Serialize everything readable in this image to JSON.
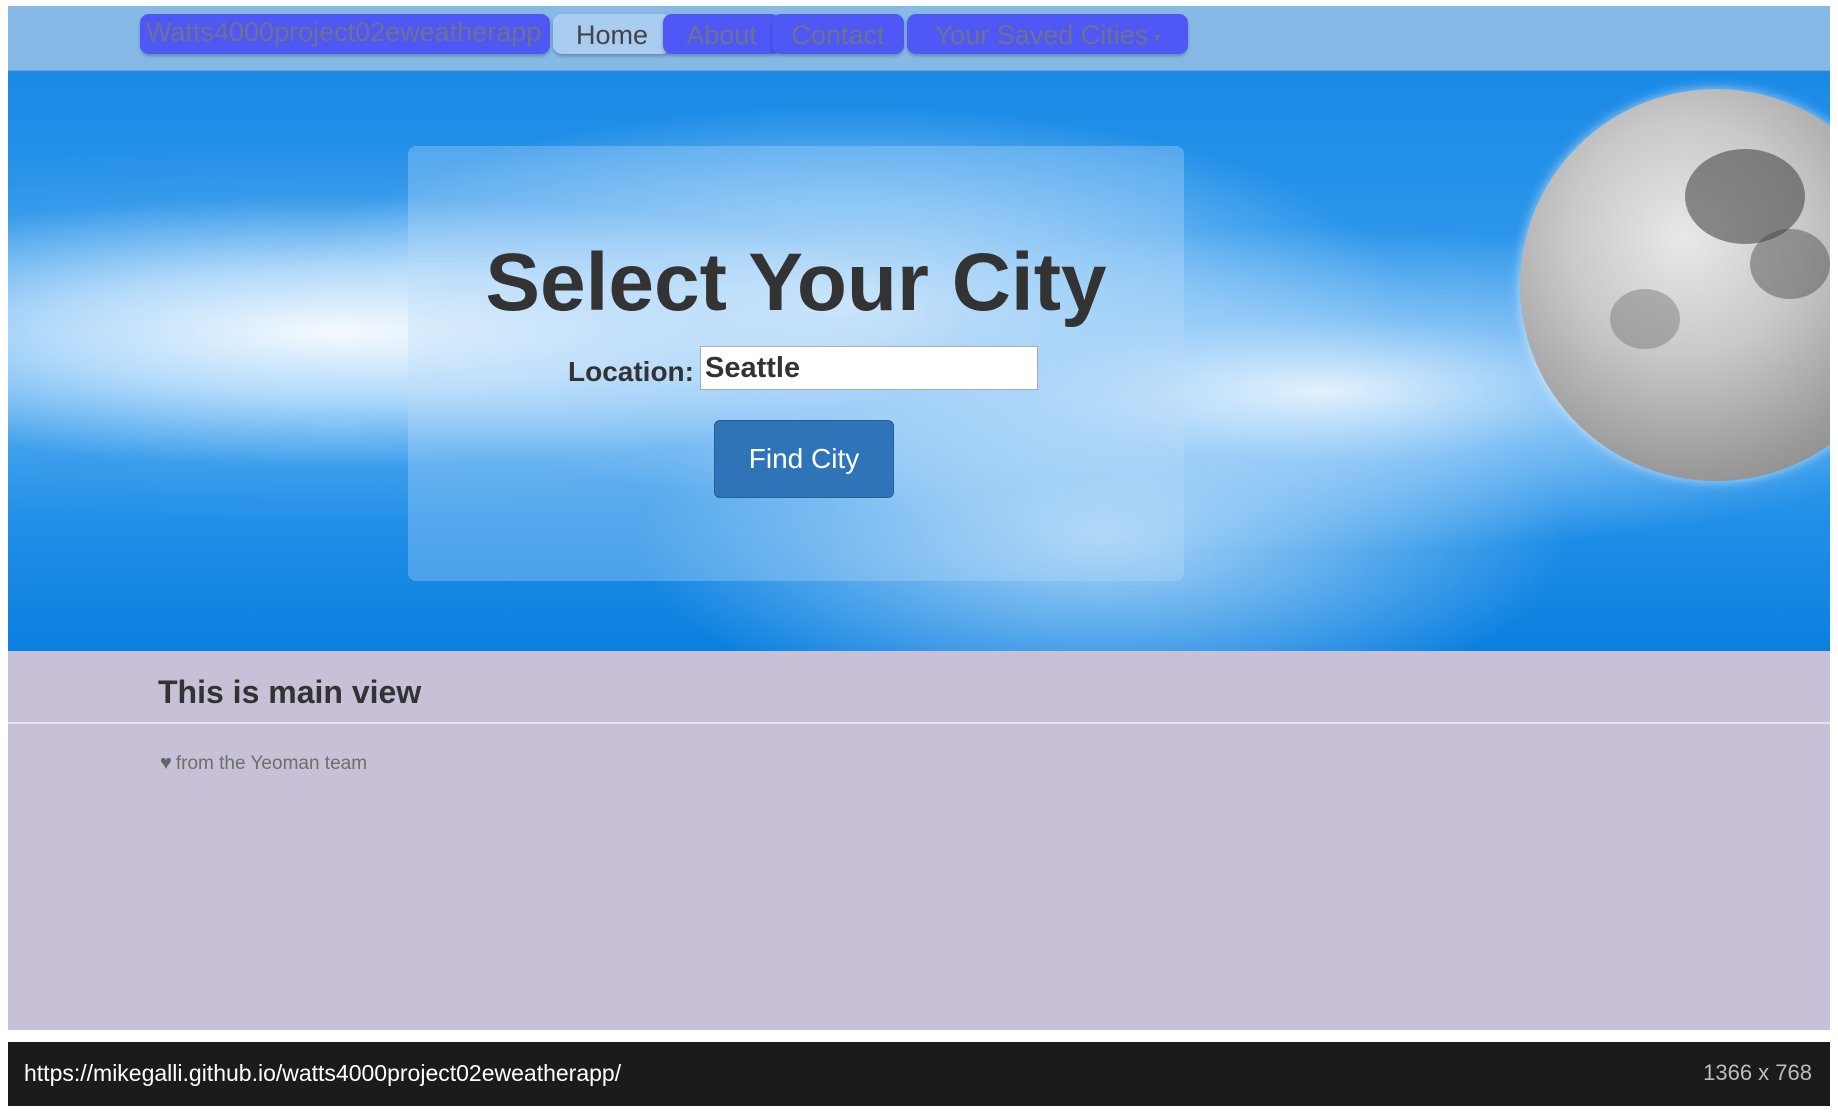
{
  "navbar": {
    "brand": "Watts4000project02eweatherapp",
    "items": [
      {
        "label": "Home",
        "active": true
      },
      {
        "label": "About"
      },
      {
        "label": "Contact"
      },
      {
        "label": "Your Saved Cities",
        "dropdown": true
      }
    ]
  },
  "hero": {
    "title": "Select Your City",
    "location_label": "Location:",
    "location_value": "Seattle",
    "find_button": "Find City"
  },
  "main": {
    "heading": "This is main view",
    "footer_text": "from the Yeoman team"
  },
  "statusbar": {
    "url": "https://mikegalli.github.io/watts4000project02eweatherapp/",
    "dimensions": "1366 x 768"
  },
  "colors": {
    "nav_button": "#4f57f4",
    "nav_active": "#a8cdf0",
    "navbar_bg": "#86b9e6",
    "primary_button": "#2f74b8",
    "main_bg": "#c8c0d6"
  },
  "icons": {
    "dropdown": "caret-down-icon",
    "footer": "heart-icon"
  }
}
